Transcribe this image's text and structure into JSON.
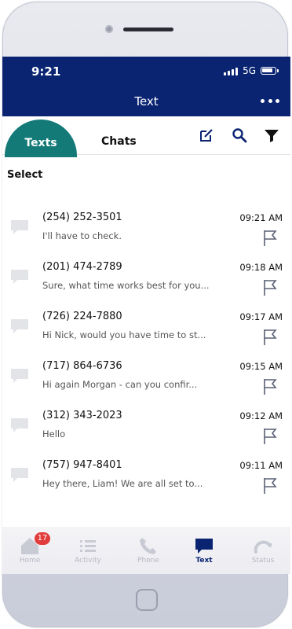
{
  "status_bar": {
    "time": "9:21",
    "network": "5G"
  },
  "header": {
    "title": "Text"
  },
  "tabs": {
    "texts": "Texts",
    "chats": "Chats"
  },
  "select_label": "Select",
  "conversations": [
    {
      "number": "(254) 252-3501",
      "preview": "I'll have to check.",
      "time": "09:21 AM"
    },
    {
      "number": "(201) 474-2789",
      "preview": "Sure, what time works best for you...",
      "time": "09:18 AM"
    },
    {
      "number": "(726) 224-7880",
      "preview": "Hi Nick, would you have time to st...",
      "time": "09:17 AM"
    },
    {
      "number": "(717) 864-6736",
      "preview": "Hi again Morgan - can you confir...",
      "time": "09:15 AM"
    },
    {
      "number": "(312) 343-2023",
      "preview": "Hello",
      "time": "09:12 AM"
    },
    {
      "number": "(757) 947-8401",
      "preview": "Hey there, Liam! We are all set to...",
      "time": "09:11 AM"
    }
  ],
  "bottom_nav": {
    "home": {
      "label": "Home",
      "badge": "17"
    },
    "activity": {
      "label": "Activity"
    },
    "phone": {
      "label": "Phone"
    },
    "text": {
      "label": "Text"
    },
    "status": {
      "label": "Status"
    }
  },
  "colors": {
    "header": "#0a2472",
    "active_tab": "#137a78",
    "badge": "#e23b3b",
    "inactive_nav": "#b6b8c2"
  },
  "icons": {
    "header_more": "more-dots-icon",
    "compose": "compose-icon",
    "search": "search-icon",
    "filter": "filter-icon",
    "conversation": "chat-bubble-icon",
    "flag": "flag-icon"
  }
}
